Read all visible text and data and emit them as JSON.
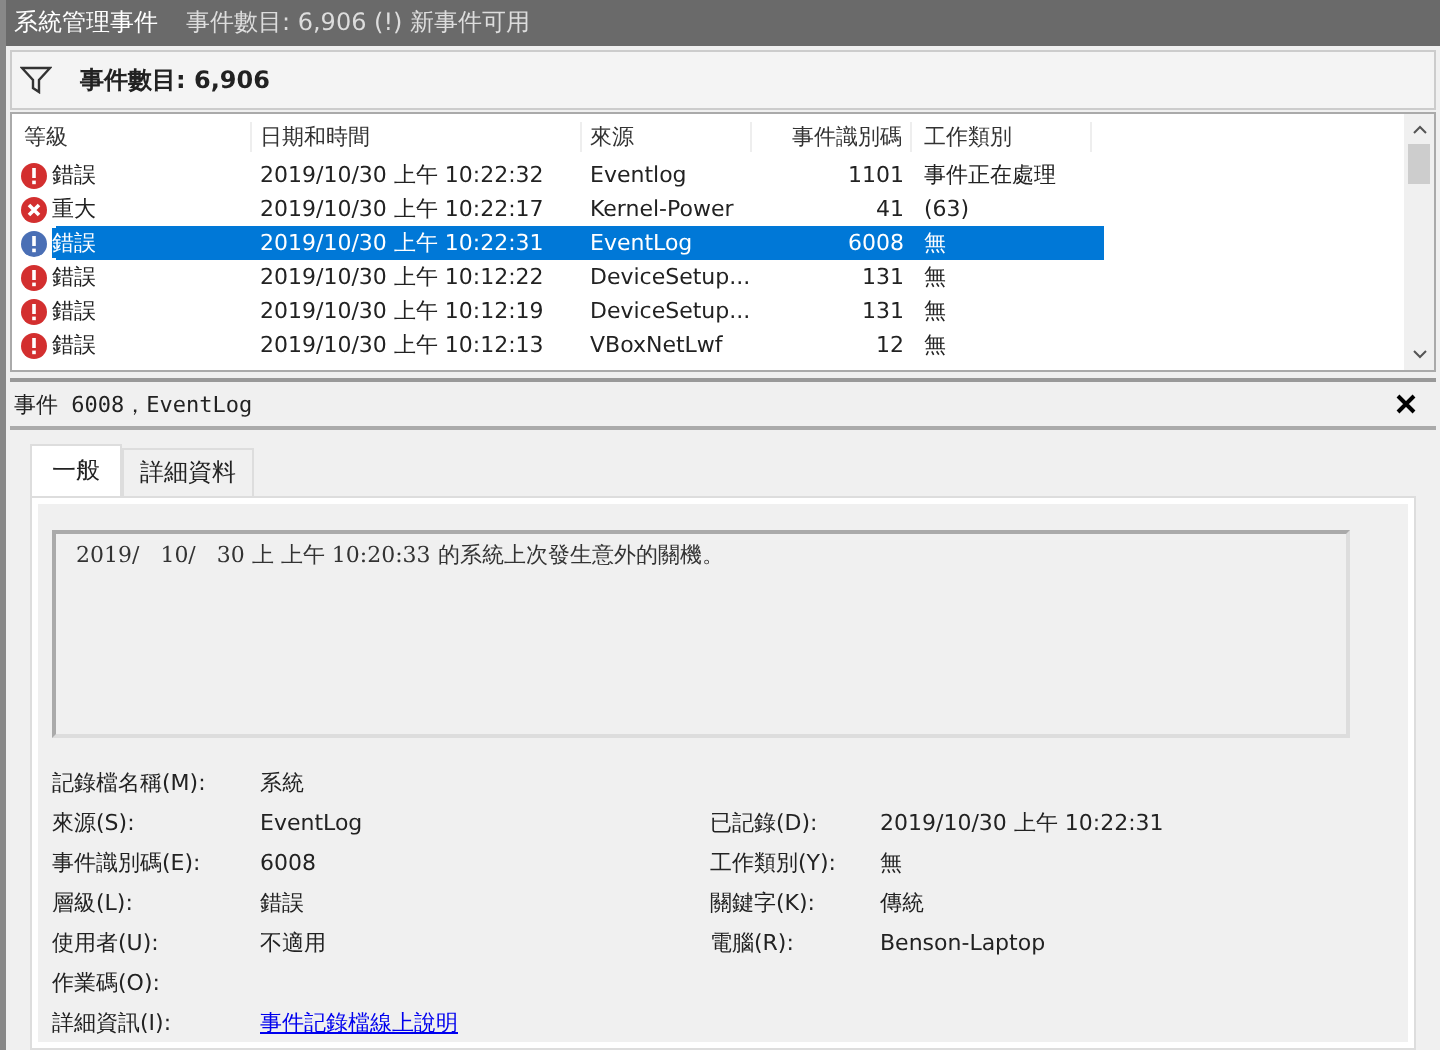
{
  "window": {
    "title": "系統管理事件",
    "subtitle": "事件數目: 6,906 (!) 新事件可用"
  },
  "filter_bar": {
    "label": "事件數目: 6,906"
  },
  "table": {
    "columns": [
      "等級",
      "日期和時間",
      "來源",
      "事件識別碼",
      "工作類別"
    ],
    "rows": [
      {
        "kind": "error",
        "level": "錯誤",
        "date": "2019/10/30 上午 10:22:32",
        "source": "Eventlog",
        "id": "1101",
        "category": "事件正在處理",
        "selected": false
      },
      {
        "kind": "critical",
        "level": "重大",
        "date": "2019/10/30 上午 10:22:17",
        "source": "Kernel-Power",
        "id": "41",
        "category": "(63)",
        "selected": false
      },
      {
        "kind": "error",
        "level": "錯誤",
        "date": "2019/10/30 上午 10:22:31",
        "source": "EventLog",
        "id": "6008",
        "category": "無",
        "selected": true
      },
      {
        "kind": "error",
        "level": "錯誤",
        "date": "2019/10/30 上午 10:12:22",
        "source": "DeviceSetup...",
        "id": "131",
        "category": "無",
        "selected": false
      },
      {
        "kind": "error",
        "level": "錯誤",
        "date": "2019/10/30 上午 10:12:19",
        "source": "DeviceSetup...",
        "id": "131",
        "category": "無",
        "selected": false
      },
      {
        "kind": "error",
        "level": "錯誤",
        "date": "2019/10/30 上午 10:12:13",
        "source": "VBoxNetLwf",
        "id": "12",
        "category": "無",
        "selected": false
      }
    ]
  },
  "detail": {
    "title": "事件 6008，EventLog",
    "tabs": [
      {
        "label": "一般",
        "selected": true
      },
      {
        "label": "詳細資料",
        "selected": false
      }
    ],
    "message": "2019/   10/   30 上 上午 10:20:33 的系統上次發生意外的關機。",
    "fields": [
      {
        "left": {
          "label": "記錄檔名稱(M):",
          "value": "系統"
        }
      },
      {
        "left": {
          "label": "來源(S):",
          "value": "EventLog"
        },
        "right": {
          "label": "已記錄(D):",
          "value": "2019/10/30 上午 10:22:31"
        }
      },
      {
        "left": {
          "label": "事件識別碼(E):",
          "value": "6008"
        },
        "right": {
          "label": "工作類別(Y):",
          "value": "無"
        }
      },
      {
        "left": {
          "label": "層級(L):",
          "value": "錯誤"
        },
        "right": {
          "label": "關鍵字(K):",
          "value": "傳統"
        }
      },
      {
        "left": {
          "label": "使用者(U):",
          "value": "不適用"
        },
        "right": {
          "label": "電腦(R):",
          "value": "Benson-Laptop"
        }
      },
      {
        "left": {
          "label": "作業碼(O):"
        }
      },
      {
        "left": {
          "label": "詳細資訊(I):",
          "value": "事件記錄檔線上說明",
          "kind": "link"
        }
      }
    ]
  }
}
